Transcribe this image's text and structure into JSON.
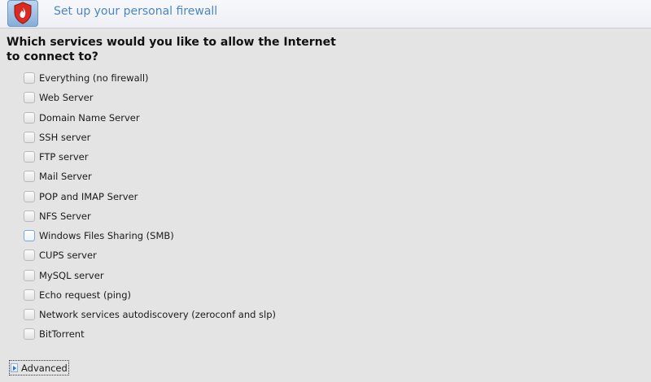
{
  "header": {
    "title": "Set up your personal firewall",
    "icon": "firewall-shield-icon"
  },
  "question": "Which services would you like to allow the Internet to connect to?",
  "services": [
    {
      "label": "Everything (no firewall)",
      "checked": false
    },
    {
      "label": "Web Server",
      "checked": false
    },
    {
      "label": "Domain Name Server",
      "checked": false
    },
    {
      "label": "SSH server",
      "checked": false
    },
    {
      "label": "FTP server",
      "checked": false
    },
    {
      "label": "Mail Server",
      "checked": false
    },
    {
      "label": "POP and IMAP Server",
      "checked": false
    },
    {
      "label": "NFS Server",
      "checked": false
    },
    {
      "label": "Windows Files Sharing (SMB)",
      "checked": false
    },
    {
      "label": "CUPS server",
      "checked": false
    },
    {
      "label": "MySQL server",
      "checked": false
    },
    {
      "label": "Echo request (ping)",
      "checked": false
    },
    {
      "label": "Network services autodiscovery (zeroconf and slp)",
      "checked": false
    },
    {
      "label": "BitTorrent",
      "checked": false
    }
  ],
  "advanced": {
    "label": "Advanced",
    "expanded": false
  },
  "colors": {
    "title": "#4b86bf",
    "accent": "#7aa7d9"
  }
}
